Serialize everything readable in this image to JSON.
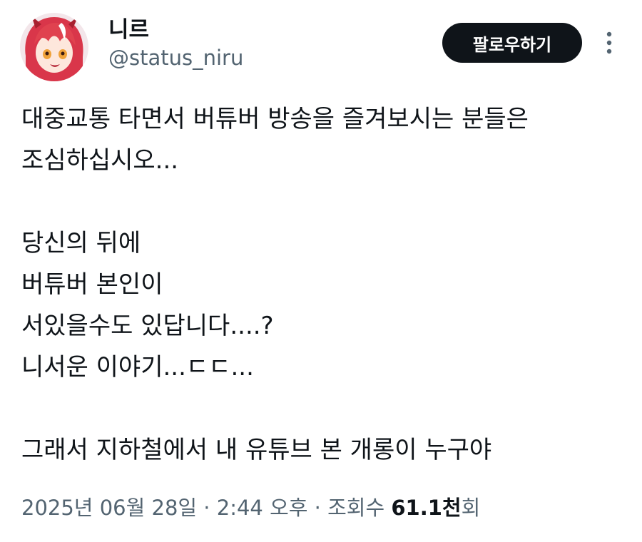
{
  "user": {
    "display_name": "니르",
    "handle": "@status_niru"
  },
  "actions": {
    "follow_label": "팔로우하기",
    "more_icon": "more-vertical-icon"
  },
  "tweet": {
    "lines": [
      "대중교통 타면서 버튜버 방송을 즐겨보시는 분들은",
      "조심하십시오...",
      "",
      "당신의 뒤에",
      "버튜버 본인이",
      "서있을수도 있답니다....?",
      "니서운 이야기...ㄷㄷ...",
      "",
      "그래서 지하철에서 내 유튜브 본 개롱이 누구야"
    ]
  },
  "meta": {
    "timestamp": "2025년 06월 28일 · 2:44 오후",
    "separator": " · ",
    "views_prefix": "조회수 ",
    "views_count": "61.1천",
    "views_suffix": "회"
  },
  "colors": {
    "text": "#0f1419",
    "secondary": "#536471",
    "follow_bg": "#0f1419",
    "follow_text": "#ffffff",
    "avatar_hair": "#d9364a"
  }
}
